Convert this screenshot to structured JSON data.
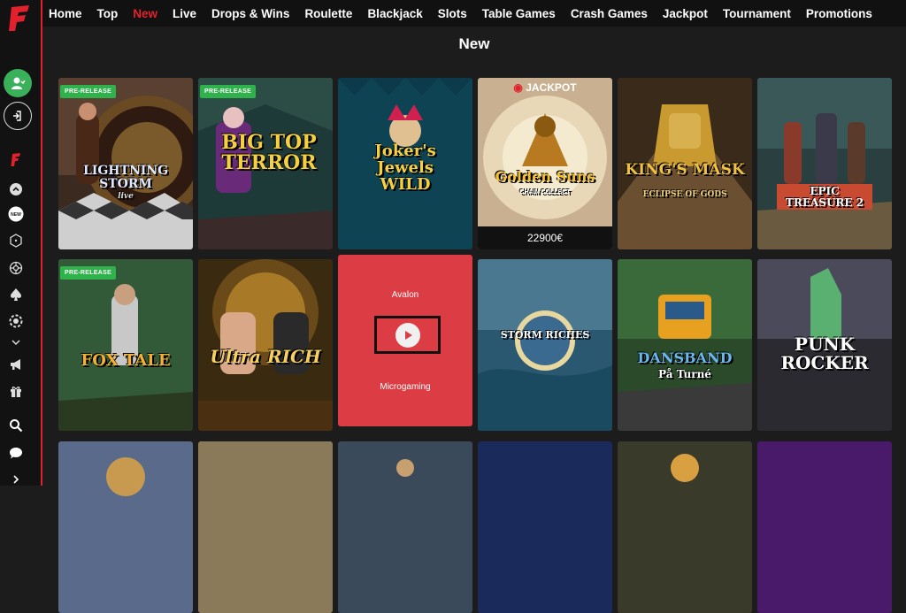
{
  "colors": {
    "accent": "#e3212d",
    "background": "#1c1c1c",
    "badge": "#2fb24c",
    "hover_tile": "#dc3c44"
  },
  "brand": {
    "logo_icon": "f-logo-icon"
  },
  "sidebar": {
    "items": [
      {
        "icon": "user-icon"
      },
      {
        "icon": "login-icon"
      },
      {
        "icon": "f-logo-icon"
      },
      {
        "icon": "chevron-up-icon"
      },
      {
        "icon": "new-icon",
        "label": "NEW"
      },
      {
        "icon": "dice-icon"
      },
      {
        "icon": "roulette-icon"
      },
      {
        "icon": "spade-icon"
      },
      {
        "icon": "chip-icon"
      },
      {
        "icon": "chevron-down-icon"
      },
      {
        "icon": "megaphone-icon"
      },
      {
        "icon": "gift-icon"
      },
      {
        "icon": "search-icon"
      },
      {
        "icon": "chat-icon"
      },
      {
        "icon": "chevron-right-icon"
      }
    ]
  },
  "nav": {
    "items": [
      "Home",
      "Top",
      "New",
      "Live",
      "Drops & Wins",
      "Roulette",
      "Blackjack",
      "Slots",
      "Table Games",
      "Crash Games",
      "Jackpot",
      "Tournament",
      "Promotions"
    ],
    "active": "New"
  },
  "page": {
    "title": "New"
  },
  "games": {
    "row1": [
      {
        "name": "LIGHTNING STORM",
        "sub": "live",
        "badge": "PRE-RELEASE"
      },
      {
        "name": "BIG TOP TERROR",
        "badge": "PRE-RELEASE"
      },
      {
        "name": "Joker's Jewels WILD"
      },
      {
        "name": "Golden Suns",
        "sub": "CHAIN COLLECT",
        "jackpot_label": "JACKPOT",
        "jackpot_amount": "22900€"
      },
      {
        "name": "KING'S MASK",
        "sub": "ECLIPSE OF GODS"
      },
      {
        "name": "EPIC TREASURE 2"
      }
    ],
    "row2": [
      {
        "name": "FOX TALE",
        "badge": "PRE-RELEASE"
      },
      {
        "name": "Ultra RICH"
      },
      {
        "name": "Avalon",
        "provider": "Microgaming",
        "play_icon": "play-icon"
      },
      {
        "name": "STORM RICHES"
      },
      {
        "name": "DANSBAND",
        "sub": "På Turné"
      },
      {
        "name": "PUNK ROCKER"
      }
    ]
  }
}
